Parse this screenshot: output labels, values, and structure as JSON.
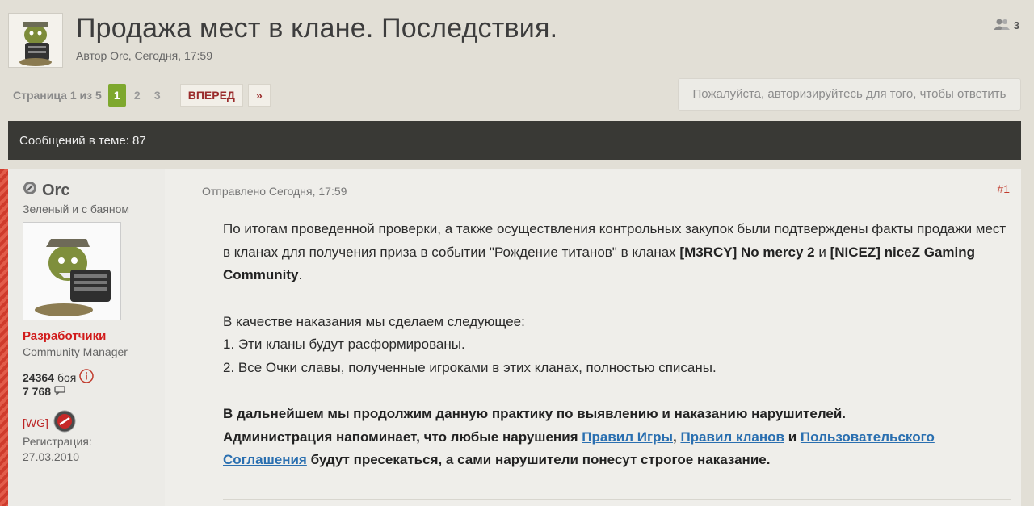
{
  "topic": {
    "title": "Продажа мест в клане. Последствия.",
    "meta": "Автор Orc, Сегодня, 17:59",
    "viewers": "3"
  },
  "pagination": {
    "label": "Страница 1 из 5",
    "pages": [
      "1",
      "2",
      "3"
    ],
    "next_label": "ВПЕРЕД",
    "last_label": "»"
  },
  "reply_prompt": "Пожалуйста, авторизируйтесь для того, чтобы ответить",
  "bar": {
    "messages_count": "Сообщений в теме: 87"
  },
  "author": {
    "name": "Orc",
    "title": "Зеленый и с баяном",
    "group": "Разработчики",
    "role": "Community Manager",
    "battles_count": "24364",
    "battles_label": "боя",
    "posts_count": "7 768",
    "clan_tag": "[WG]",
    "reg_label": "Регистрация:",
    "reg_date": "27.03.2010"
  },
  "post": {
    "date": "Отправлено Сегодня, 17:59",
    "number": "#1",
    "p1_text1": "По итогам проведенной проверки, а также осуществления контрольных закупок были подтверждены факты продажи мест в кланах для получения приза в событии \"Рождение титанов\" в кланах ",
    "p1_bold1": "[M3RCY] No mercy 2",
    "p1_text2": " и ",
    "p1_bold2": "[NICEZ] niceZ Gaming Community",
    "p1_text3": ".",
    "p2_line1": "В качестве наказания мы сделаем следующее:",
    "p2_line2": "1. Эти кланы будут расформированы.",
    "p2_line3": "2. Все Очки славы, полученные игроками в этих кланах, полностью списаны.",
    "p3_line1": "В дальнейшем мы продолжим данную практику по выявлению и наказанию нарушителей.",
    "p3_text1": "Администрация напоминает, что любые нарушения ",
    "p3_link1": "Правил Игры",
    "p3_sep1": ", ",
    "p3_link2": "Правил кланов",
    "p3_sep2": " и ",
    "p3_link3": "Пользовательского Соглашения",
    "p3_text2": " будут пресекаться, а сами нарушители понесут строгое наказание."
  }
}
